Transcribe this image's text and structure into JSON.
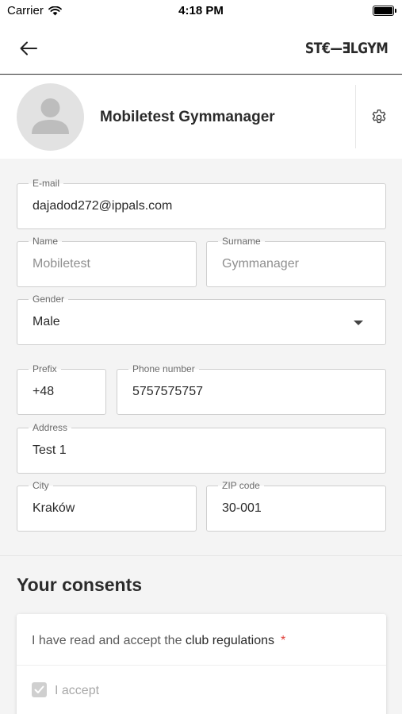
{
  "status_bar": {
    "carrier": "Carrier",
    "time": "4:18 PM"
  },
  "navbar": {
    "logo_text": "ST€—∃LGYM",
    "back_icon": "arrow-left-icon"
  },
  "profile": {
    "name": "Mobiletest Gymmanager",
    "avatar_icon": "user-silhouette-icon",
    "settings_icon": "gear-icon"
  },
  "form": {
    "email": {
      "label": "E-mail",
      "value": "dajadod272@ippals.com"
    },
    "name": {
      "label": "Name",
      "value": "Mobiletest"
    },
    "surname": {
      "label": "Surname",
      "value": "Gymmanager"
    },
    "gender": {
      "label": "Gender",
      "value": "Male"
    },
    "prefix": {
      "label": "Prefix",
      "value": "+48"
    },
    "phone": {
      "label": "Phone number",
      "value": "5757575757"
    },
    "address": {
      "label": "Address",
      "value": "Test 1"
    },
    "city": {
      "label": "City",
      "value": "Kraków"
    },
    "zip": {
      "label": "ZIP code",
      "value": "30-001"
    }
  },
  "consents": {
    "title": "Your consents",
    "items": [
      {
        "text_prefix": "I have read and accept the ",
        "link_text": "club regulations",
        "required_mark": "*",
        "checkbox_label": "I accept",
        "checked": true
      }
    ]
  },
  "colors": {
    "required": "#e0413b",
    "background": "#f4f4f4"
  }
}
